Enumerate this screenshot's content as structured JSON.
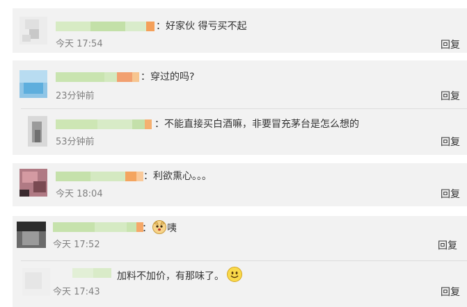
{
  "comments": [
    {
      "text": "：好家伙 得亏买不起",
      "time": "今天 17:54",
      "reply_label": "回复",
      "emoji": null,
      "avatar_colors": [
        "#e9e9e9",
        "#cfcfcf",
        "#bcbcbc"
      ]
    },
    {
      "text": "：穿过的吗?",
      "time": "23分钟前",
      "reply_label": "回复",
      "emoji": null,
      "avatar_colors": [
        "#a8d4ee",
        "#5eaedd",
        "#8fc5e6"
      ]
    },
    {
      "text": "：不能直接买白酒嘛，非要冒充茅台是怎么想的",
      "time": "53分钟前",
      "reply_label": "回复",
      "emoji": null,
      "avatar_colors": [
        "#d9d9d9",
        "#8a8a8a",
        "#c4c4c4"
      ]
    },
    {
      "text": "：利欲熏心。。。",
      "time": "今天 18:04",
      "reply_label": "回复",
      "emoji": null,
      "avatar_colors": [
        "#b07a84",
        "#7a4a52",
        "#d49aa2"
      ]
    },
    {
      "text": "：",
      "text_after_emoji": "咦",
      "time": "今天 17:52",
      "reply_label": "回复",
      "emoji": "cat-face-emoji",
      "avatar_colors": [
        "#2c2c2c",
        "#6b6b6b",
        "#9a9a9a"
      ]
    },
    {
      "text": "加料不加价，有那味了。",
      "time": "今天 17:43",
      "reply_label": "回复",
      "emoji": "smiley-emoji",
      "avatar_colors": [
        "#f2f2f2",
        "#e4e4e4",
        "#ececec"
      ]
    }
  ],
  "colors": {
    "block_bg": "#f2f2f2",
    "text": "#333333",
    "time_text": "#808080",
    "divider": "#dcdcdc",
    "name_blur_green": "#cfe6b9",
    "name_blur_orange": "#f4a05a"
  }
}
